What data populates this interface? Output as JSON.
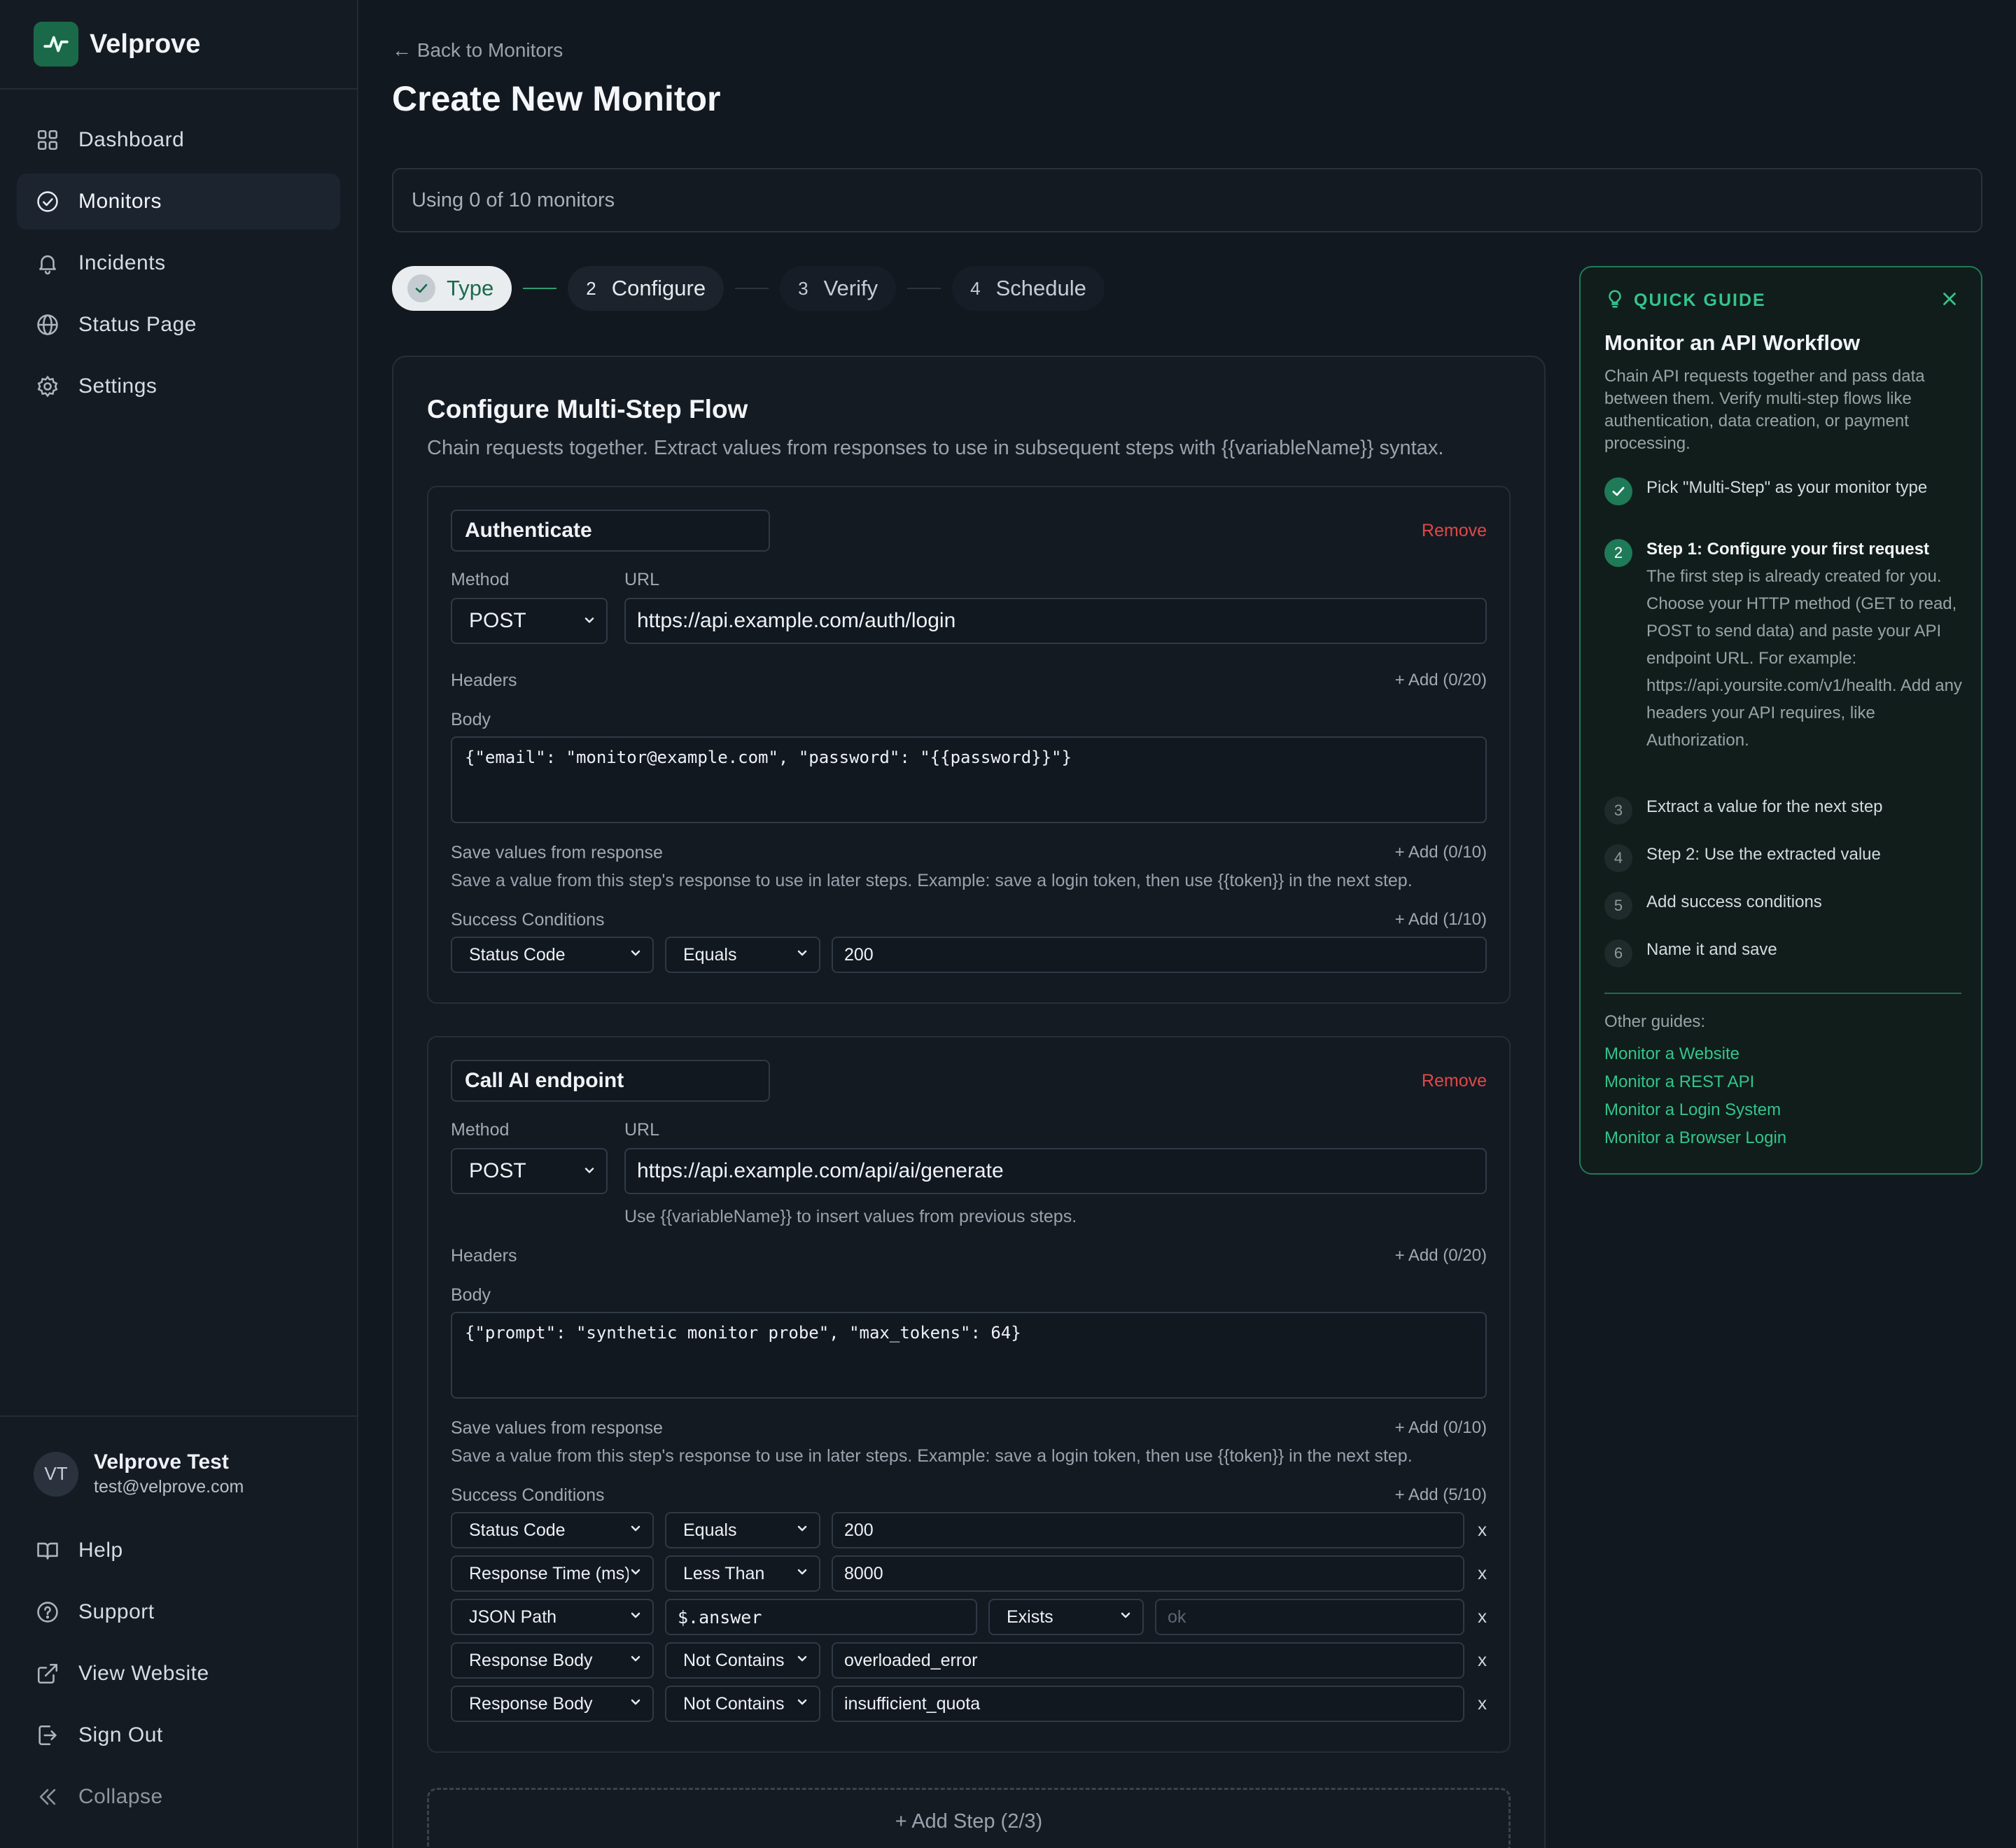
{
  "brand": {
    "name": "Velprove"
  },
  "nav": [
    {
      "label": "Dashboard",
      "icon": "grid-icon"
    },
    {
      "label": "Monitors",
      "icon": "check-circle-icon",
      "active": true
    },
    {
      "label": "Incidents",
      "icon": "bell-icon"
    },
    {
      "label": "Status Page",
      "icon": "globe-icon"
    },
    {
      "label": "Settings",
      "icon": "gear-icon"
    }
  ],
  "user": {
    "initials": "VT",
    "name": "Velprove Test",
    "email": "test@velprove.com"
  },
  "bottom_nav": [
    {
      "label": "Help",
      "icon": "book-icon"
    },
    {
      "label": "Support",
      "icon": "question-circle-icon"
    },
    {
      "label": "View Website",
      "icon": "external-link-icon"
    },
    {
      "label": "Sign Out",
      "icon": "sign-out-icon"
    },
    {
      "label": "Collapse",
      "icon": "double-chevron-left-icon"
    }
  ],
  "header": {
    "back": "← Back to Monitors",
    "title": "Create New Monitor"
  },
  "usage": "Using 0 of 10 monitors",
  "stepper": [
    {
      "num": "",
      "label": "Type",
      "state": "done"
    },
    {
      "num": "2",
      "label": "Configure",
      "state": "current"
    },
    {
      "num": "3",
      "label": "Verify",
      "state": "upcoming"
    },
    {
      "num": "4",
      "label": "Schedule",
      "state": "upcoming"
    }
  ],
  "config": {
    "title": "Configure Multi-Step Flow",
    "subtitle": "Chain requests together. Extract values from responses to use in subsequent steps with {{variableName}} syntax.",
    "labels": {
      "method": "Method",
      "url": "URL",
      "headers": "Headers",
      "body": "Body",
      "save_values": "Save values from response",
      "save_values_help": "Save a value from this step's response to use in later steps. Example: save a login token, then use {{token}} in the next step.",
      "success": "Success Conditions",
      "remove": "Remove",
      "variable_help": "Use {{variableName}} to insert values from previous steps.",
      "remove_x": "x"
    },
    "steps": [
      {
        "name": "Authenticate",
        "method": "POST",
        "url": "https://api.example.com/auth/login",
        "headers_add": "+ Add (0/20)",
        "body": "{\"email\": \"monitor@example.com\", \"password\": \"{{password}}\"}",
        "save_add": "+ Add (0/10)",
        "success_add": "+ Add (1/10)",
        "conditions": [
          {
            "field": "Status Code",
            "operator": "Equals",
            "value": "200"
          }
        ]
      },
      {
        "name": "Call AI endpoint",
        "method": "POST",
        "url": "https://api.example.com/api/ai/generate",
        "headers_add": "+ Add (0/20)",
        "body": "{\"prompt\": \"synthetic monitor probe\", \"max_tokens\": 64}",
        "save_add": "+ Add (0/10)",
        "success_add": "+ Add (5/10)",
        "conditions": [
          {
            "field": "Status Code",
            "operator": "Equals",
            "value": "200"
          },
          {
            "field": "Response Time (ms)",
            "operator": "Less Than",
            "value": "8000"
          },
          {
            "field": "JSON Path",
            "path": "$.answer",
            "operator": "Exists",
            "value": "",
            "placeholder": "ok"
          },
          {
            "field": "Response Body",
            "operator": "Not Contains",
            "value": "overloaded_error"
          },
          {
            "field": "Response Body",
            "operator": "Not Contains",
            "value": "insufficient_quota"
          }
        ]
      }
    ],
    "add_step": "+ Add Step (2/3)"
  },
  "guide": {
    "heading": "QUICK GUIDE",
    "title": "Monitor an API Workflow",
    "description": "Chain API requests together and pass data between them. Verify multi-step flows like authentication, data creation, or payment processing.",
    "steps": [
      {
        "num": "",
        "text": "Pick \"Multi-Step\" as your monitor type",
        "state": "done"
      },
      {
        "num": "2",
        "text": "Step 1: Configure your first request",
        "state": "current",
        "detail": "The first step is already created for you. Choose your HTTP method (GET to read, POST to send data) and paste your API endpoint URL. For example: https://api.yoursite.com/v1/health. Add any headers your API requires, like Authorization."
      },
      {
        "num": "3",
        "text": "Extract a value for the next step",
        "state": "upcoming"
      },
      {
        "num": "4",
        "text": "Step 2: Use the extracted value",
        "state": "upcoming"
      },
      {
        "num": "5",
        "text": "Add success conditions",
        "state": "upcoming"
      },
      {
        "num": "6",
        "text": "Name it and save",
        "state": "upcoming"
      }
    ],
    "other_label": "Other guides:",
    "links": [
      "Monitor a Website",
      "Monitor a REST API",
      "Monitor a Login System",
      "Monitor a Browser Login"
    ]
  },
  "colors": {
    "accent": "#34c48c",
    "accent_dark": "#1f7a57",
    "danger": "#e04848",
    "background": "#121820"
  }
}
